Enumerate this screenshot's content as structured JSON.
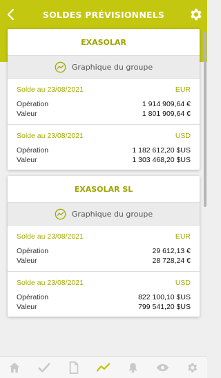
{
  "header": {
    "title": "SOLDES PRÉVISIONNELS"
  },
  "colors": {
    "accent": "#c3c70f",
    "accent_text": "#9ea300",
    "nav_active": "#c3c70f",
    "nav_inactive": "#c9c9c9"
  },
  "cards": [
    {
      "title": "EXASOLAR",
      "graph_label": "Graphique du groupe",
      "balances": [
        {
          "date_label": "Solde au 23/08/2021",
          "currency": "EUR",
          "operation_label": "Opération",
          "operation_value": "1 914 909,64 €",
          "valeur_label": "Valeur",
          "valeur_value": "1 801 909,64 €"
        },
        {
          "date_label": "Solde au 23/08/2021",
          "currency": "USD",
          "operation_label": "Opération",
          "operation_value": "1 182 612,20 $US",
          "valeur_label": "Valeur",
          "valeur_value": "1 303 468,20 $US"
        }
      ]
    },
    {
      "title": "EXASOLAR SL",
      "graph_label": "Graphique du groupe",
      "balances": [
        {
          "date_label": "Solde au 23/08/2021",
          "currency": "EUR",
          "operation_label": "Opération",
          "operation_value": "29 612,13 €",
          "valeur_label": "Valeur",
          "valeur_value": "28 728,24 €"
        },
        {
          "date_label": "Solde au 23/08/2021",
          "currency": "USD",
          "operation_label": "Opération",
          "operation_value": "822 100,10 $US",
          "valeur_label": "Valeur",
          "valeur_value": "799 541,20 $US"
        }
      ]
    }
  ],
  "bottom_nav": [
    {
      "icon": "home-icon",
      "active": false
    },
    {
      "icon": "check-icon",
      "active": false
    },
    {
      "icon": "document-icon",
      "active": false
    },
    {
      "icon": "trend-icon",
      "active": true
    },
    {
      "icon": "bell-icon",
      "active": false
    },
    {
      "icon": "eye-icon",
      "active": false
    },
    {
      "icon": "gear-icon",
      "active": false
    }
  ]
}
